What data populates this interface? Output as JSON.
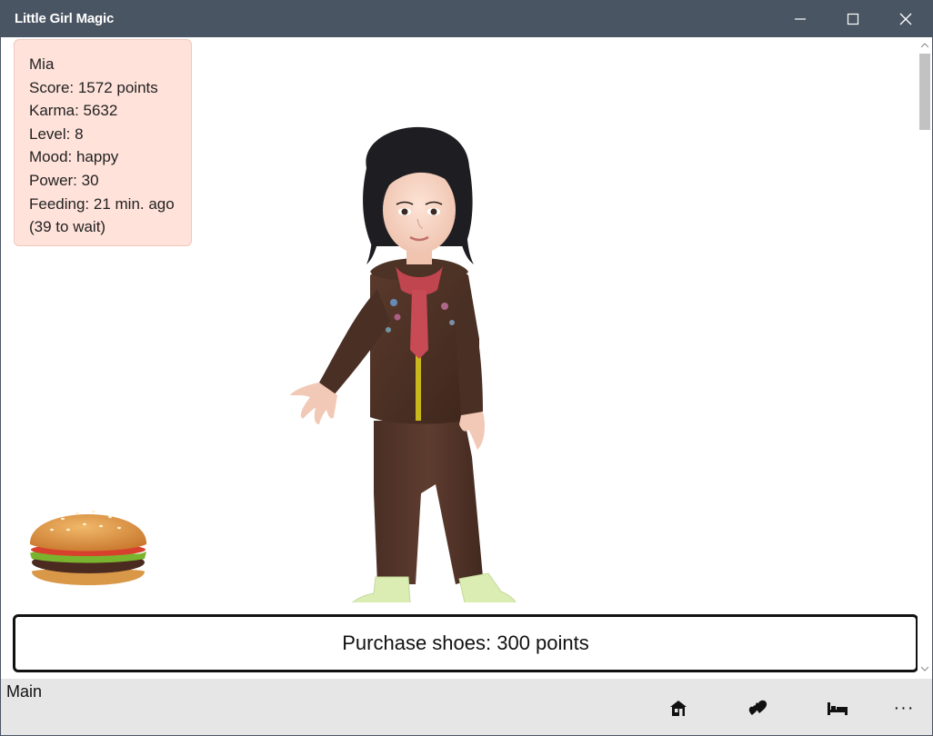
{
  "window": {
    "title": "Little Girl Magic"
  },
  "stats": {
    "name": "Mia",
    "score": "Score: 1572 points",
    "karma": "Karma: 5632",
    "level": "Level: 8",
    "mood": "Mood: happy",
    "power": "Power: 30",
    "feeding": "Feeding: 21 min. ago",
    "wait": "(39 to wait)"
  },
  "purchase": {
    "label": "Purchase shoes: 300 points"
  },
  "appbar": {
    "label": "Main",
    "more": "···",
    "buttons": [
      "home-icon",
      "hearts-icon",
      "bed-icon",
      "more-icon"
    ]
  },
  "colors": {
    "titlebar": "#4a5563",
    "stats_panel": "#ffe2da",
    "appbar": "#e6e6e6"
  }
}
